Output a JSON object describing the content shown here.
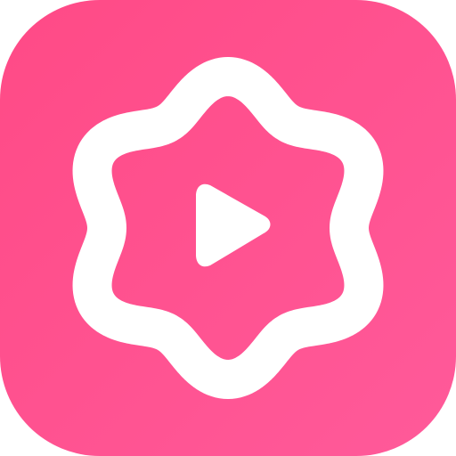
{
  "icon": {
    "name": "flower-play-icon",
    "colors": {
      "background_start": "#ff4a86",
      "background_end": "#ff5a9a",
      "foreground": "#ffffff"
    }
  }
}
